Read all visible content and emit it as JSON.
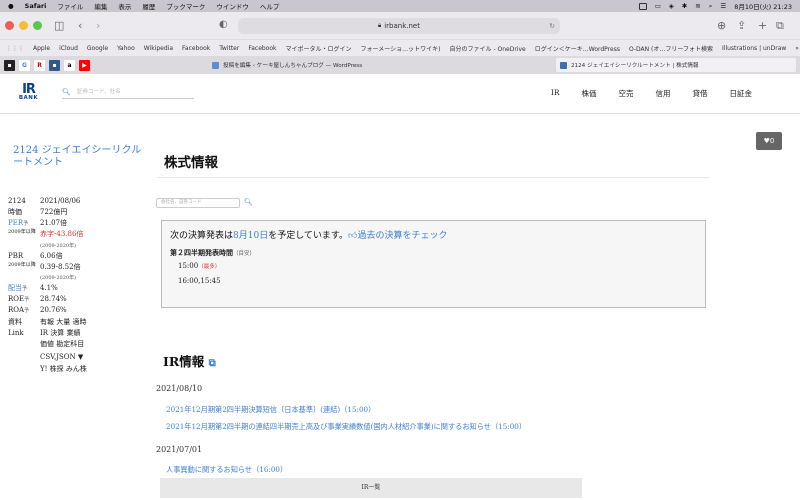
{
  "menubar": {
    "apple": "",
    "app": "Safari",
    "items": [
      "ファイル",
      "編集",
      "表示",
      "履歴",
      "ブックマーク",
      "ウインドウ",
      "ヘルプ"
    ],
    "clock": "8月10日(火)  21:23"
  },
  "browser": {
    "url": "irbank.net",
    "bookmarks": [
      "Apple",
      "iCloud",
      "Google",
      "Yahoo",
      "Wikipedia",
      "Facebook",
      "Twitter",
      "Facebook",
      "マイポータル・ログイン",
      "フォーメーショ…ットワイキ)",
      "自分のファイル - OneDrive",
      "ログイン＜ケーキ…WordPress",
      "O-DAN (オ…フリーフォト検索",
      "Illustrations | unDraw"
    ],
    "tabs": [
      {
        "title": "投稿を編集 ‹ ケーキ屋しんちゃんブログ — WordPress"
      },
      {
        "title": "2124 ジェイエイシーリクルートメント | 株式情報"
      }
    ]
  },
  "site": {
    "logo_top": "IR",
    "logo_bottom": "BANK",
    "search_placeholder": "証券コード、社名",
    "nav": [
      "IR",
      "株価",
      "空売",
      "信用",
      "貸借",
      "日証金"
    ]
  },
  "sidebar": {
    "company": "2124 ジェイエイシーリクルートメント",
    "code": "2124",
    "date": "2021/08/06",
    "rows": [
      {
        "k": "時価",
        "v": "722億円"
      },
      {
        "k": "PER",
        "sup": "予",
        "v": "21.07倍"
      },
      {
        "k": "2009年以降",
        "v": "赤字-43.86倍",
        "sub": "(2009-2020年)"
      },
      {
        "k": "PBR",
        "v": "6.06倍"
      },
      {
        "k": "2009年以降",
        "v": "0.39-8.52倍",
        "sub": "(2009-2020年)"
      },
      {
        "k": "配当",
        "sup": "予",
        "v": "4.1%"
      },
      {
        "k": "ROE",
        "sup": "予",
        "v": "28.74%"
      },
      {
        "k": "ROA",
        "sup": "予",
        "v": "20.76%"
      }
    ],
    "docs_label": "資料",
    "docs": "有報  大量  適時",
    "link_label": "Link",
    "links1": "IR  決算  業績",
    "links2": "価値  勘定科目",
    "links3": "CSV,JSON",
    "links4": "Y!  株探  みん株",
    "heart": "♥0"
  },
  "main": {
    "title": "株式情報",
    "search_placeholder": "会社名、証券コード",
    "settlement_pre": "次の決算発表は",
    "settlement_date": "8月10日",
    "settlement_post": "を予定しています。",
    "past_check": "過去の決算をチェック",
    "q_title": "第２四半期発表時間",
    "q_note": "（目安）",
    "time1": "15:00",
    "time1_note": "（最多）",
    "time2": "16:00,15:45",
    "ir_title": "IR情報",
    "ir": [
      {
        "date": "2021/08/10",
        "items": [
          "2021年12月期第2四半期決算短信〔日本基準〕(連結)（15:00）",
          "2021年12月期第2四半期の連結四半期売上高及び事業実績数値(国内人材紹介事業)に関するお知らせ（15:00）"
        ]
      },
      {
        "date": "2021/07/01",
        "items": [
          "人事異動に関するお知らせ（16:00）"
        ]
      }
    ],
    "ir_footer": "IR一覧"
  }
}
